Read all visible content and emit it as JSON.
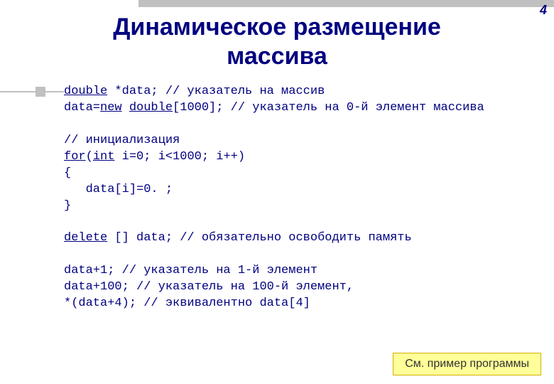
{
  "page_number": "4",
  "title": "Динамическое размещение массива",
  "code": {
    "l01a": "double",
    "l01b": " *data; // указатель на массив",
    "l02a": "data=",
    "l02b": "new",
    "l02c": " ",
    "l02d": "double",
    "l02e": "[1000]; // указатель на 0-й элемент массива",
    "blank1": "",
    "l03": "// инициализация",
    "l04a": "for",
    "l04b": "(",
    "l04c": "int",
    "l04d": " i=0; i<1000; i++)",
    "l05": "{",
    "l06": "   data[i]=0. ;",
    "l07": "}",
    "blank2": "",
    "l08a": "delete",
    "l08b": " [] data; // обязательно освободить память",
    "blank3": "",
    "l09": "data+1; // указатель на 1-й элемент",
    "l10": "data+100; // указатель на 100-й элемент,",
    "l11": "*(data+4); // эквивалентно data[4]"
  },
  "footer": "См. пример программы"
}
